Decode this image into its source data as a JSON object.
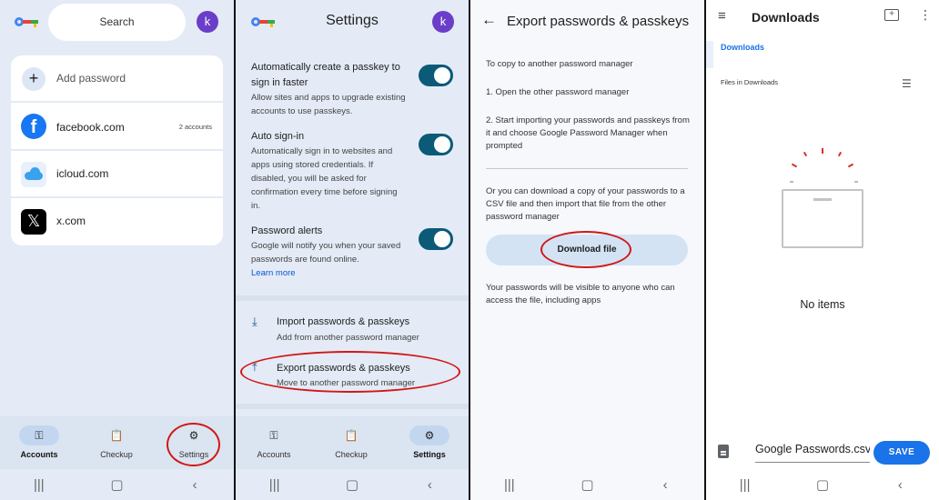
{
  "panel1": {
    "search_label": "Search",
    "avatar_letter": "k",
    "add_password": "Add password",
    "entries": [
      {
        "name": "facebook.com",
        "badge": "2 accounts"
      },
      {
        "name": "icloud.com",
        "badge": ""
      },
      {
        "name": "x.com",
        "badge": ""
      }
    ],
    "nav": [
      {
        "label": "Accounts",
        "icon": "key-icon"
      },
      {
        "label": "Checkup",
        "icon": "clipboard-check-icon"
      },
      {
        "label": "Settings",
        "icon": "gear-icon"
      }
    ]
  },
  "panel2": {
    "title": "Settings",
    "avatar_letter": "k",
    "passkey_title": "Automatically create a passkey to sign in faster",
    "passkey_desc": "Allow sites and apps to upgrade existing accounts to use passkeys.",
    "autosignin_title": "Auto sign-in",
    "autosignin_desc": "Automatically sign in to websites and apps using stored credentials. If disabled, you will be asked for confirmation every time before signing in.",
    "alerts_title": "Password alerts",
    "alerts_desc": "Google will notify you when your saved passwords are found online.",
    "learn_more": "Learn more",
    "import_title": "Import passwords & passkeys",
    "import_desc": "Add from another password manager",
    "export_title": "Export passwords & passkeys",
    "export_desc": "Move to another password manager",
    "nav": [
      {
        "label": "Accounts"
      },
      {
        "label": "Checkup"
      },
      {
        "label": "Settings"
      }
    ]
  },
  "panel3": {
    "title": "Export passwords & passkeys",
    "intro": "To copy to another password manager",
    "step1": "1. Open the other password manager",
    "step2": "2. Start importing your passwords and passkeys from it and choose Google Password Manager when prompted",
    "alt": "Or you can download a copy of your passwords to a CSV file and then import that file from the other password manager",
    "download_button": "Download file",
    "warning": "Your passwords will be visible to anyone who can access the file, including apps"
  },
  "panel4": {
    "title": "Downloads",
    "breadcrumb": "Downloads",
    "section_label": "Files in Downloads",
    "empty_text": "No items",
    "filename": "Google Passwords.csv",
    "save_button": "SAVE"
  },
  "colors": {
    "accent": "#0b5a78",
    "brand_blue": "#1a73e8",
    "highlight_red": "#d01818"
  }
}
